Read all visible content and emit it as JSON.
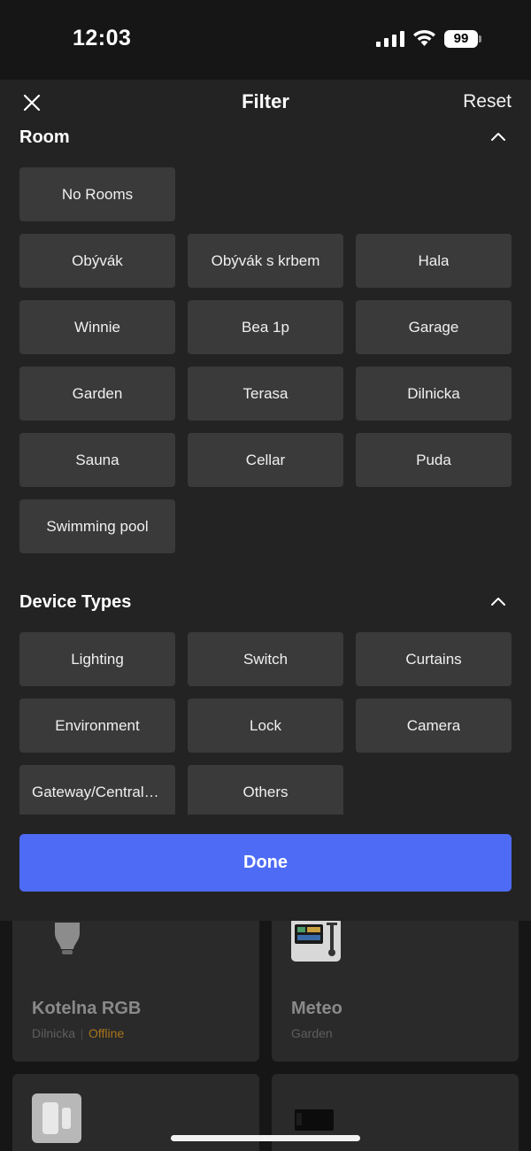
{
  "status": {
    "time": "12:03",
    "battery": "99"
  },
  "header": {
    "title": "Filter",
    "reset_label": "Reset"
  },
  "room": {
    "title": "Room",
    "items": [
      "No Rooms",
      "Obývák",
      "Obývák s krbem",
      "Hala",
      "Winnie",
      "Bea 1p",
      "Garage",
      "Garden",
      "Terasa",
      "Dilnicka",
      "Sauna",
      "Cellar",
      "Puda",
      "Swimming pool"
    ]
  },
  "device_types": {
    "title": "Device Types",
    "items": [
      "Lighting",
      "Switch",
      "Curtains",
      "Environment",
      "Lock",
      "Camera",
      "Gateway/Central Controller",
      "Others"
    ]
  },
  "done_label": "Done",
  "devices": [
    {
      "name": "Kotelna RGB",
      "room": "Dilnicka",
      "status": "Offline",
      "icon": "bulb-icon"
    },
    {
      "name": "Meteo",
      "room": "Garden",
      "icon": "weather-station-icon"
    },
    {
      "icon": "door-sensor-icon"
    },
    {
      "icon": "camera-device-icon"
    }
  ],
  "colors": {
    "accent": "#4d6bf5",
    "offline": "#a8741a",
    "chip": "#3a3a3a",
    "sheet": "#232323"
  }
}
